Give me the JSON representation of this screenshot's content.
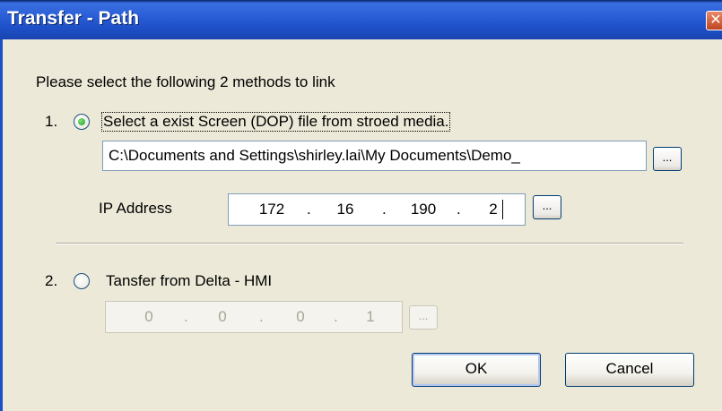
{
  "window": {
    "title": "Transfer - Path",
    "close_glyph": "✕"
  },
  "instruction": "Please select the following 2 methods to link",
  "option1": {
    "number": "1.",
    "label": "Select a exist  Screen (DOP) file from stroed media.",
    "selected": true,
    "file_path": "C:\\Documents and Settings\\shirley.lai\\My Documents\\Demo_",
    "browse_label": "...",
    "ip_label": "IP Address",
    "ip": [
      "172",
      "16",
      "190",
      "2"
    ],
    "ip_browse_label": "..."
  },
  "option2": {
    "number": "2.",
    "label": "Tansfer from Delta - HMI",
    "selected": false,
    "ip": [
      "0",
      "0",
      "0",
      "1"
    ],
    "browse_label": "..."
  },
  "buttons": {
    "ok": "OK",
    "cancel": "Cancel"
  },
  "ip_separator": "."
}
